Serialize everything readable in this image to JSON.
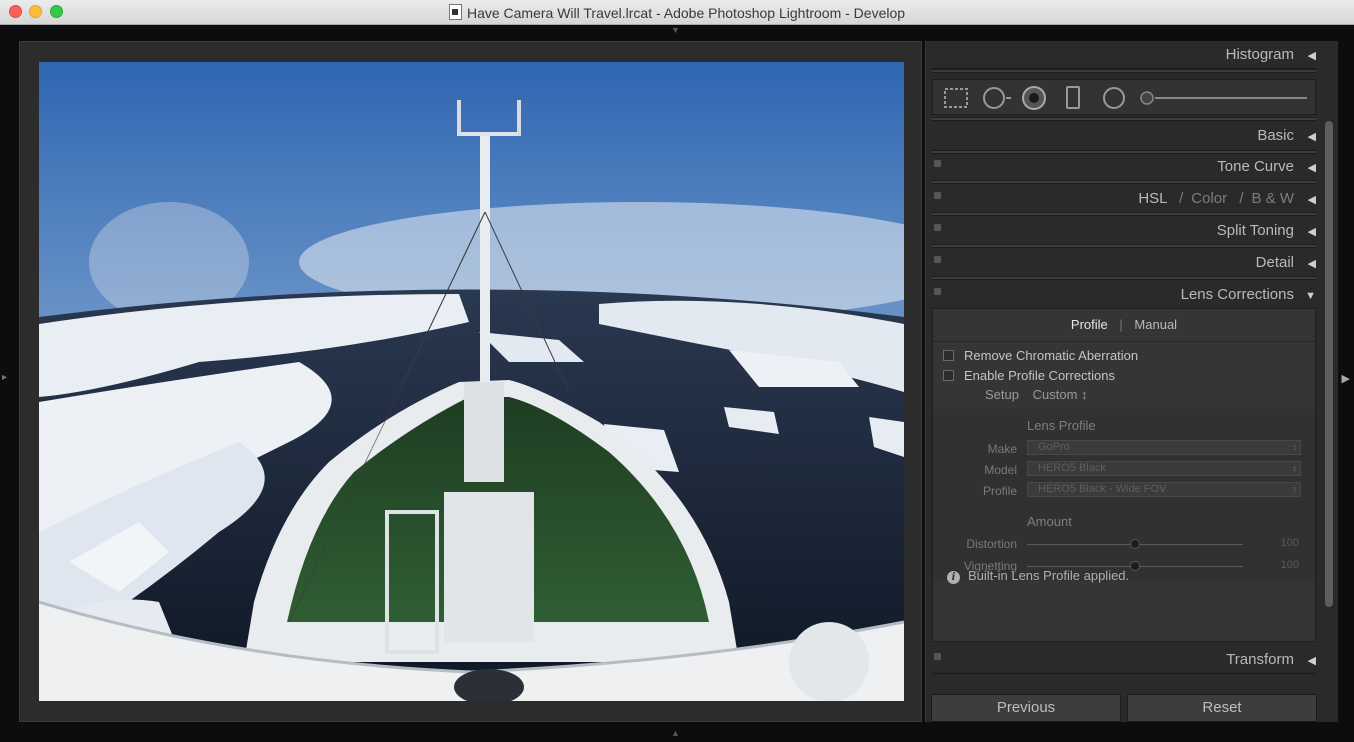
{
  "window": {
    "title": "Have Camera Will Travel.lrcat - Adobe Photoshop Lightroom - Develop"
  },
  "panels": {
    "histogram": "Histogram",
    "basic": "Basic",
    "tone_curve": "Tone Curve",
    "hsl": {
      "hsl": "HSL",
      "sep1": "/",
      "color": "Color",
      "sep2": "/",
      "bw": "B & W"
    },
    "split_toning": "Split Toning",
    "detail": "Detail",
    "lens_corrections": "Lens Corrections",
    "transform": "Transform"
  },
  "lens": {
    "tabs": {
      "profile": "Profile",
      "sep": "|",
      "manual": "Manual"
    },
    "remove_ca": "Remove Chromatic Aberration",
    "enable_profile": "Enable Profile Corrections",
    "setup_label": "Setup",
    "setup_value": "Custom ↕",
    "lens_profile_title": "Lens Profile",
    "make_label": "Make",
    "make_value": "GoPro",
    "model_label": "Model",
    "model_value": "HERO5 Black",
    "profile_label": "Profile",
    "profile_value": "HERO5 Black - Wide FOV",
    "amount_title": "Amount",
    "distortion_label": "Distortion",
    "distortion_value": "100",
    "vignetting_label": "Vignetting",
    "vignetting_value": "100",
    "info": "Built-in Lens Profile applied."
  },
  "buttons": {
    "previous": "Previous",
    "reset": "Reset"
  },
  "icons": [
    "crop-icon",
    "spot-removal-icon",
    "red-eye-icon",
    "graduated-filter-icon",
    "radial-filter-icon",
    "brush-icon"
  ],
  "colors": {
    "panel_bg": "#2a2a2a",
    "window_bg": "#0d0d0d",
    "sky": "#3f74b8",
    "water": "#1d2a3d",
    "deck": "#2e5b2e"
  }
}
